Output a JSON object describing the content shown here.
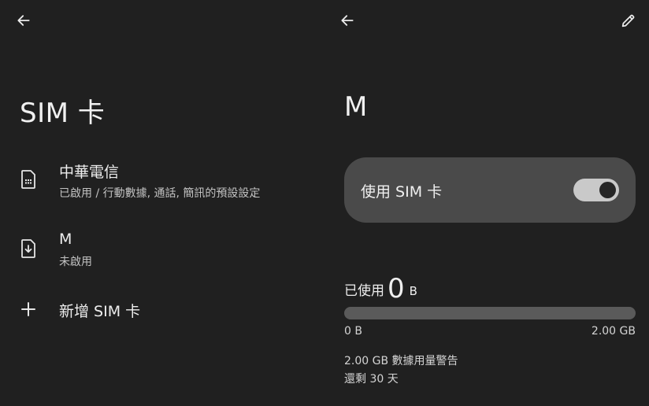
{
  "left_pane": {
    "title": "SIM 卡",
    "items": [
      {
        "title": "中華電信",
        "subtitle": "已啟用 / 行動數據, 通話, 簡訊的預設設定",
        "icon": "sim-card-icon"
      },
      {
        "title": "M",
        "subtitle": "未啟用",
        "icon": "esim-download-icon"
      },
      {
        "title": "新增 SIM 卡",
        "icon": "plus-icon"
      }
    ],
    "back_icon": "arrow-left-icon"
  },
  "right_pane": {
    "title": "M",
    "back_icon": "arrow-left-icon",
    "edit_icon": "pencil-icon",
    "toggle": {
      "label": "使用 SIM 卡",
      "on": true
    },
    "usage": {
      "prefix": "已使用",
      "value": "0",
      "unit": "B",
      "fraction_used": 0,
      "min_label": "0 B",
      "max_label": "2.00 GB",
      "warning": "2.00 GB 數據用量警告",
      "days_left": "還剩 30 天"
    }
  },
  "colors": {
    "background": "#202020",
    "card": "#4a4a4a",
    "switch_track": "#c9c9c9",
    "switch_thumb": "#262626",
    "progress_track": "#5a5a5a"
  }
}
